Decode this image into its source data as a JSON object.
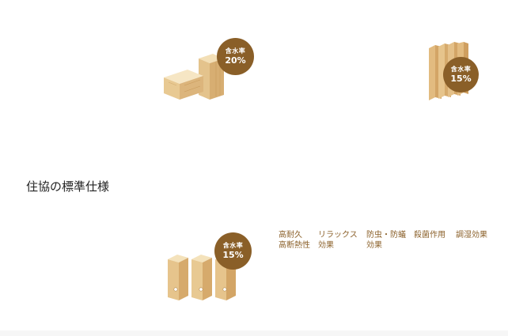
{
  "products": [
    {
      "badge_label": "含水率",
      "badge_value": "20%",
      "icon": "wood-blocks-image"
    },
    {
      "badge_label": "含水率",
      "badge_value": "15%",
      "icon": "wood-boards-image"
    },
    {
      "badge_label": "含水率",
      "badge_value": "15%",
      "icon": "wood-posts-image"
    }
  ],
  "section": {
    "title": "住協の標準仕様"
  },
  "features": [
    "高耐久\n高断熱性",
    "リラックス\n効果",
    "防虫・防蟻\n効果",
    "殺菌作用",
    "調湿効果"
  ],
  "colors": {
    "badge": "#8a5f28",
    "feature_text": "#8a5f28",
    "wood_light": "#e9cf9f",
    "wood_mid": "#d9b27a"
  }
}
